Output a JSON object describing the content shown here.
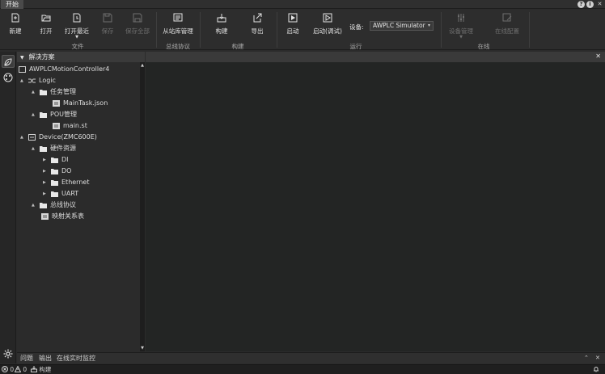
{
  "ribbon_tab": "开始",
  "window_controls": {
    "help": "?",
    "info": "i",
    "close": "✕"
  },
  "ribbon": {
    "new": "新建",
    "open": "打开",
    "open_recent": "打开最近",
    "save": "保存",
    "save_all": "保存全部",
    "slave_mgmt": "从站库管理",
    "build": "构建",
    "export": "导出",
    "start": "启动",
    "start_debug": "启动(调试)",
    "device_label": "设备:",
    "device_value": "AWPLC Simulator",
    "device_mgmt": "设备管理",
    "online_config": "在线配置",
    "groups": {
      "file": "文件",
      "bus": "总线协议",
      "build": "构建",
      "run": "运行",
      "online": "在线"
    }
  },
  "solution": {
    "title": "解决方案",
    "tree": [
      {
        "label": "AWPLCMotionController4",
        "icon": "project-icon"
      },
      {
        "label": "Logic",
        "icon": "logic-icon"
      },
      {
        "label": "任务管理",
        "icon": "folder-icon"
      },
      {
        "label": "MainTask.json",
        "icon": "file-icon"
      },
      {
        "label": "POU管理",
        "icon": "folder-icon"
      },
      {
        "label": "main.st",
        "icon": "file-icon"
      },
      {
        "label": "Device(ZMC600E)",
        "icon": "device-icon"
      },
      {
        "label": "硬件资源",
        "icon": "folder-icon"
      },
      {
        "label": "DI",
        "icon": "folder-icon"
      },
      {
        "label": "DO",
        "icon": "folder-icon"
      },
      {
        "label": "Ethernet",
        "icon": "folder-icon"
      },
      {
        "label": "UART",
        "icon": "folder-icon"
      },
      {
        "label": "总线协议",
        "icon": "folder-icon"
      },
      {
        "label": "映射关系表",
        "icon": "file-icon"
      }
    ]
  },
  "bottom_tabs": {
    "problems": "问题",
    "output": "输出",
    "monitor": "在线实时监控"
  },
  "status": {
    "errors": "0",
    "warnings": "0",
    "build": "构建"
  }
}
